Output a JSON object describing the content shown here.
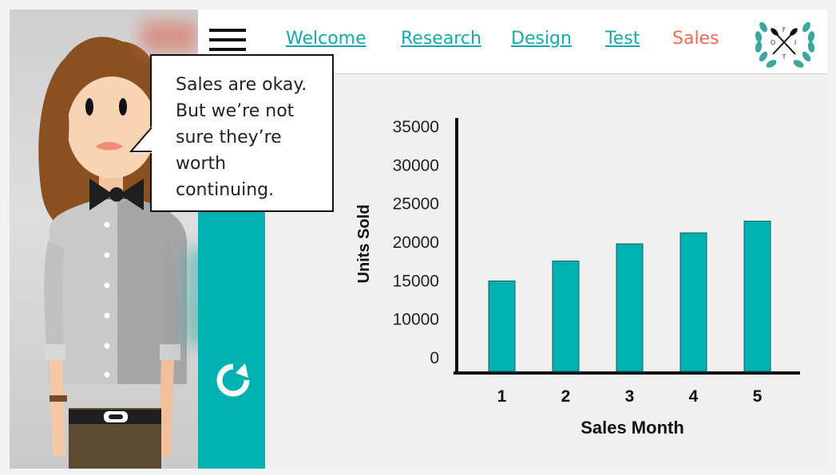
{
  "nav": {
    "links": [
      "Welcome",
      "Research",
      "Design",
      "Test",
      "Sales"
    ],
    "active": "Sales",
    "logo_letters": [
      "F",
      "O",
      "I",
      "T"
    ]
  },
  "bubble": {
    "lines": [
      "Sales are okay.",
      "But we’re not",
      "sure they’re",
      "worth",
      "continuing."
    ]
  },
  "colors": {
    "teal": "#00b1b2",
    "active_link": "#ef6a55",
    "link": "#17a9aa"
  },
  "icons": {
    "menu": "menu-icon",
    "refresh": "refresh-icon",
    "logo": "laurel-oars-logo"
  },
  "chart_data": {
    "type": "bar",
    "categories": [
      "1",
      "2",
      "3",
      "4",
      "5"
    ],
    "values": [
      15000,
      17900,
      20400,
      22000,
      23700
    ],
    "xlabel": "Sales Month",
    "ylabel": "Units Sold",
    "yticks": [
      0,
      5000,
      10000,
      15000,
      20000,
      25000,
      30000,
      35000
    ],
    "ytick_labels": [
      "0",
      "10000",
      "15000",
      "20000",
      "25000",
      "30000",
      "35000"
    ],
    "ylim": [
      0,
      35000
    ],
    "bar_color": "#00b1b2",
    "grid": false,
    "legend": false
  }
}
